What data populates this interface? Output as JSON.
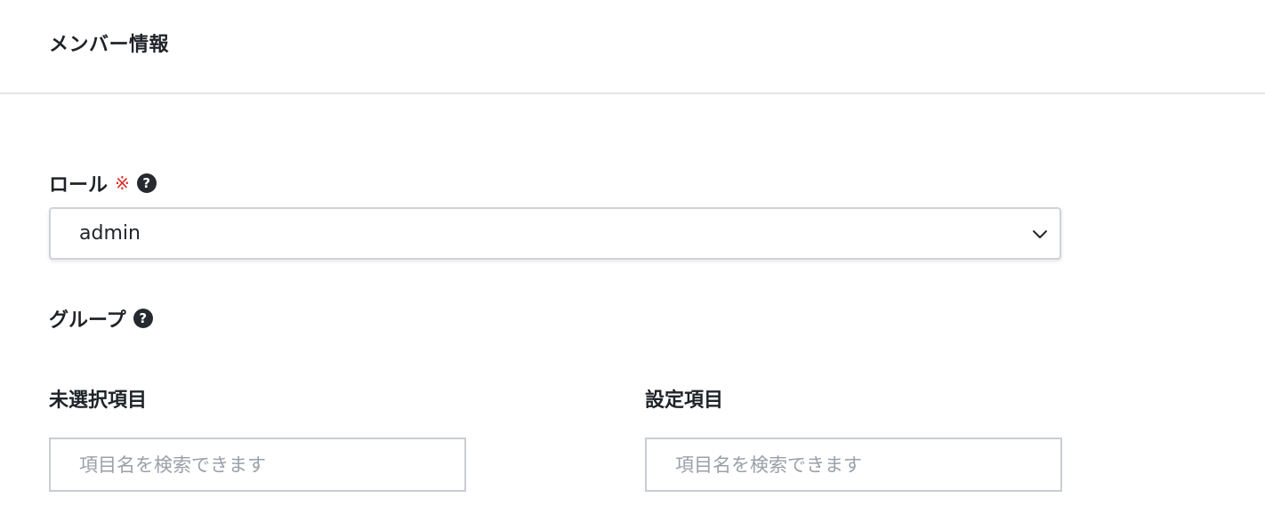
{
  "header": {
    "title": "メンバー情報"
  },
  "role": {
    "label": "ロール",
    "required_mark": "※",
    "help_icon": "question-circle-icon",
    "selected_value": "admin",
    "dropdown_icon": "chevron-down-icon"
  },
  "group": {
    "label": "グループ",
    "help_icon": "question-circle-icon",
    "unselected": {
      "title": "未選択項目",
      "search_placeholder": "項目名を検索できます",
      "search_value": ""
    },
    "selected": {
      "title": "設定項目",
      "search_placeholder": "項目名を検索できます",
      "search_value": ""
    }
  },
  "colors": {
    "required_mark": "#d9302c",
    "help_icon": "#262a2f",
    "divider": "#e3e5e8",
    "input_border": "#c9cdd3",
    "placeholder": "#9aa0a8"
  }
}
